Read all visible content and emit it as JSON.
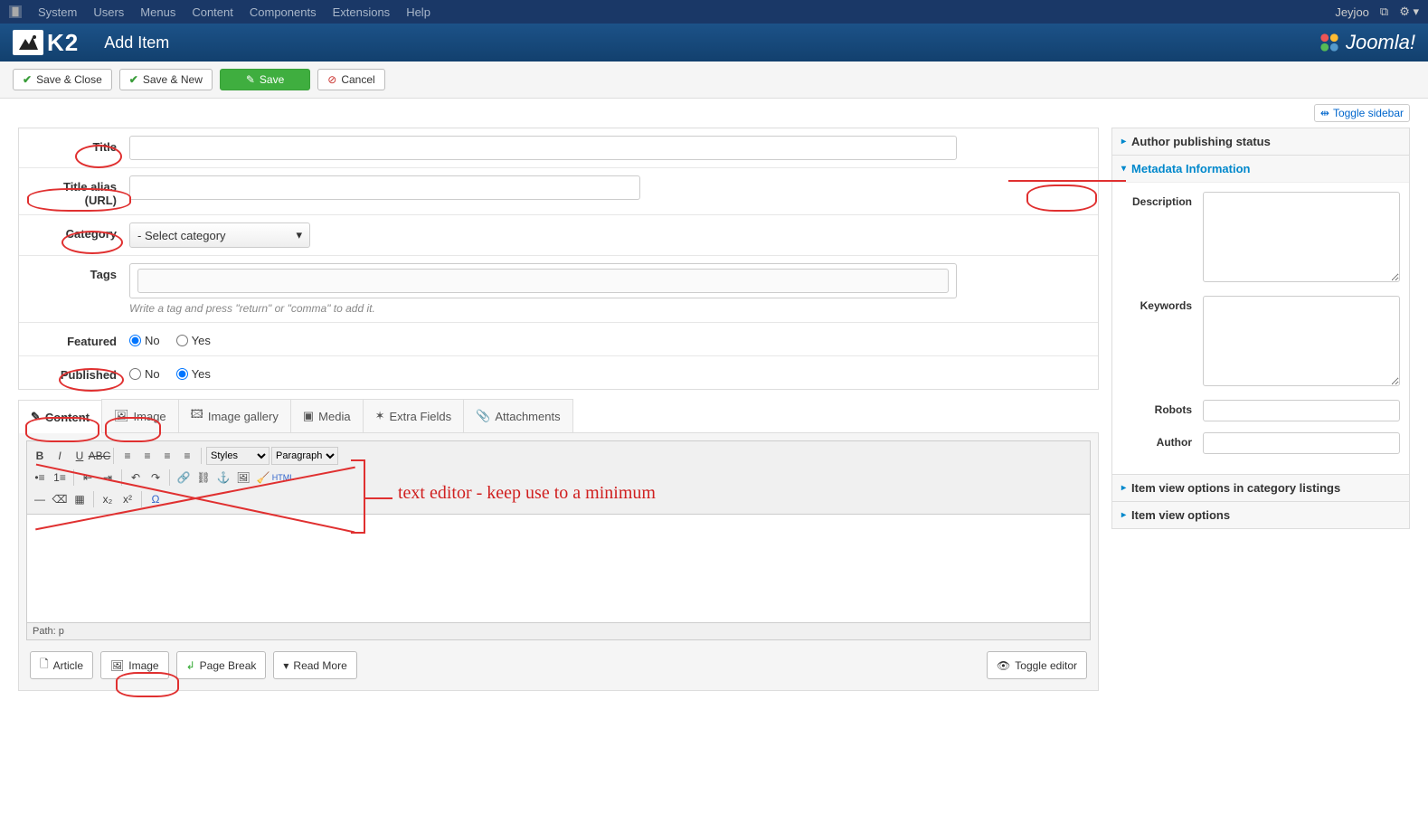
{
  "topnav": {
    "menu": [
      "System",
      "Users",
      "Menus",
      "Content",
      "Components",
      "Extensions",
      "Help"
    ],
    "user": "Jeyjoo"
  },
  "header": {
    "k2": "K2",
    "title": "Add Item",
    "brand": "Joomla!"
  },
  "toolbar": {
    "save_close": "Save & Close",
    "save_new": "Save & New",
    "save": "Save",
    "cancel": "Cancel"
  },
  "toggle_sidebar": "Toggle sidebar",
  "form": {
    "title_label": "Title",
    "title_value": "",
    "alias_label": "Title alias (URL)",
    "alias_value": "",
    "category_label": "Category",
    "category_value": "- Select category",
    "tags_label": "Tags",
    "tags_hint": "Write a tag and press \"return\" or \"comma\" to add it.",
    "featured_label": "Featured",
    "published_label": "Published",
    "no": "No",
    "yes": "Yes"
  },
  "tabs": [
    "Content",
    "Image",
    "Image gallery",
    "Media",
    "Extra Fields",
    "Attachments"
  ],
  "editor": {
    "styles": "Styles",
    "paragraph": "Paragraph",
    "path": "Path: p",
    "article_btn": "Article",
    "image_btn": "Image",
    "pagebreak_btn": "Page Break",
    "readmore_btn": "Read More",
    "toggle_editor_btn": "Toggle editor"
  },
  "sidebar": {
    "author_pub": "Author publishing status",
    "metadata": "Metadata Information",
    "description_label": "Description",
    "keywords_label": "Keywords",
    "robots_label": "Robots",
    "author_label": "Author",
    "item_view_cat": "Item view options in category listings",
    "item_view": "Item view options"
  },
  "annotation_text": "text editor - keep use to a minimum"
}
